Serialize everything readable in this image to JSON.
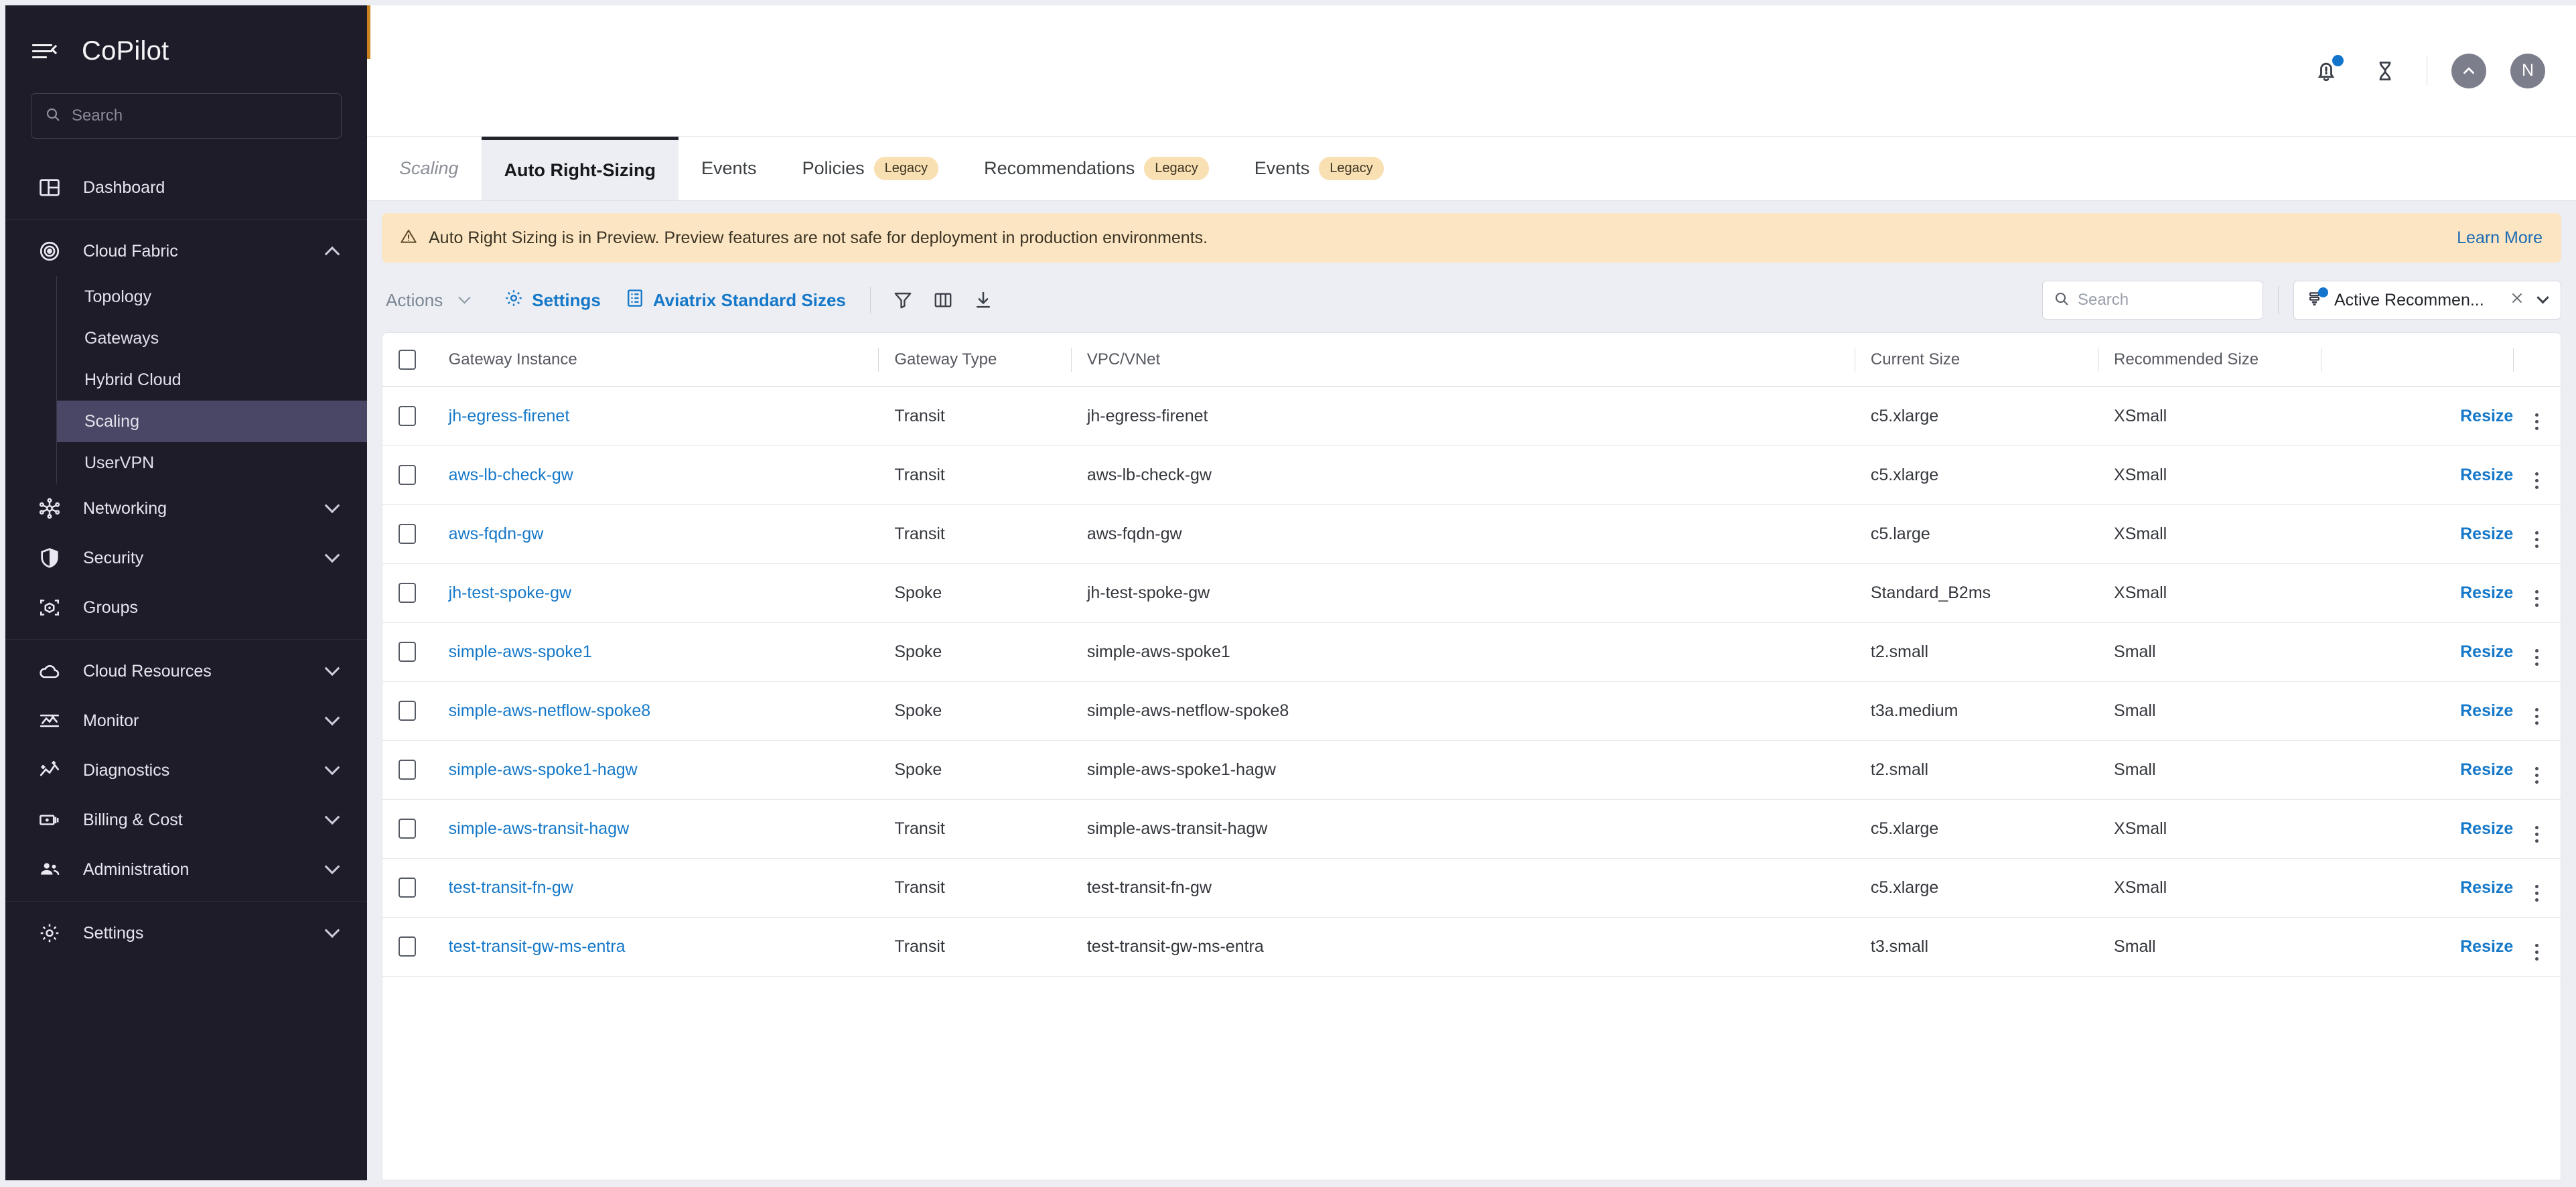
{
  "brand": {
    "title": "CoPilot",
    "menu_icon": "hamburger-collapse-icon"
  },
  "sidebar": {
    "search": {
      "placeholder": "Search",
      "value": "",
      "icon": "search-icon"
    },
    "items": [
      {
        "label": "Dashboard",
        "icon": "dashboard-icon",
        "expandable": false
      },
      {
        "label": "Cloud Fabric",
        "icon": "target-icon",
        "expandable": true,
        "expanded": true,
        "children": [
          {
            "label": "Topology",
            "active": false
          },
          {
            "label": "Gateways",
            "active": false
          },
          {
            "label": "Hybrid Cloud",
            "active": false
          },
          {
            "label": "Scaling",
            "active": true
          },
          {
            "label": "UserVPN",
            "active": false
          }
        ]
      },
      {
        "label": "Networking",
        "icon": "network-nodes-icon",
        "expandable": true,
        "expanded": false
      },
      {
        "label": "Security",
        "icon": "shield-icon",
        "expandable": true,
        "expanded": false
      },
      {
        "label": "Groups",
        "icon": "groups-cube-icon",
        "expandable": false
      },
      {
        "label": "Cloud Resources",
        "icon": "cloud-icon",
        "expandable": true,
        "expanded": false
      },
      {
        "label": "Monitor",
        "icon": "monitor-icon",
        "expandable": true,
        "expanded": false
      },
      {
        "label": "Diagnostics",
        "icon": "diagnostics-icon",
        "expandable": true,
        "expanded": false
      },
      {
        "label": "Billing & Cost",
        "icon": "money-icon",
        "expandable": true,
        "expanded": false
      },
      {
        "label": "Administration",
        "icon": "people-icon",
        "expandable": true,
        "expanded": false
      },
      {
        "label": "Settings",
        "icon": "gear-icon",
        "expandable": true,
        "expanded": false
      }
    ]
  },
  "topbar": {
    "notifications_icon": "bell-alert-icon",
    "has_notification_dot": true,
    "hourglass_icon": "hourglass-icon",
    "collapse_icon": "chevron-up-circle-icon",
    "avatar_initial": "N"
  },
  "tabs": [
    {
      "label": "Scaling",
      "active": false,
      "breadcrumb": true,
      "badge": null
    },
    {
      "label": "Auto Right-Sizing",
      "active": true,
      "breadcrumb": false,
      "badge": null
    },
    {
      "label": "Events",
      "active": false,
      "breadcrumb": false,
      "badge": null
    },
    {
      "label": "Policies",
      "active": false,
      "breadcrumb": false,
      "badge": "Legacy"
    },
    {
      "label": "Recommendations",
      "active": false,
      "breadcrumb": false,
      "badge": "Legacy"
    },
    {
      "label": "Events",
      "active": false,
      "breadcrumb": false,
      "badge": "Legacy"
    }
  ],
  "banner": {
    "icon": "warning-triangle-icon",
    "text": "Auto Right Sizing is in Preview. Preview features are not safe for deployment in production environments.",
    "link_label": "Learn More",
    "bg_color": "#fbe5c2",
    "link_color": "#1b6bb5"
  },
  "toolbar": {
    "actions_label": "Actions",
    "settings_label": "Settings",
    "settings_icon": "gear-icon",
    "standard_sizes_label": "Aviatrix Standard Sizes",
    "standard_sizes_icon": "list-document-icon",
    "filter_icon": "funnel-icon",
    "columns_icon": "columns-icon",
    "download_icon": "download-icon",
    "search": {
      "placeholder": "Search",
      "value": "",
      "icon": "search-icon"
    },
    "filter_chip": {
      "icon": "saved-filter-icon",
      "label": "Active Recommen...",
      "clear_icon": "close-icon",
      "caret_icon": "chevron-down-icon",
      "has_dot": true
    },
    "accent_color": "#1578c8"
  },
  "table": {
    "select_all_checkbox": false,
    "columns": [
      "Gateway Instance",
      "Gateway Type",
      "VPC/VNet",
      "Current Size",
      "Recommended Size"
    ],
    "action_label": "Resize",
    "row_menu_icon": "kebab-menu-icon",
    "rows": [
      {
        "checked": false,
        "gateway_instance": "jh-egress-firenet",
        "gateway_type": "Transit",
        "vpc_vnet": "jh-egress-firenet",
        "current_size": "c5.xlarge",
        "recommended_size": "XSmall"
      },
      {
        "checked": false,
        "gateway_instance": "aws-lb-check-gw",
        "gateway_type": "Transit",
        "vpc_vnet": "aws-lb-check-gw",
        "current_size": "c5.xlarge",
        "recommended_size": "XSmall"
      },
      {
        "checked": false,
        "gateway_instance": "aws-fqdn-gw",
        "gateway_type": "Transit",
        "vpc_vnet": "aws-fqdn-gw",
        "current_size": "c5.large",
        "recommended_size": "XSmall"
      },
      {
        "checked": false,
        "gateway_instance": "jh-test-spoke-gw",
        "gateway_type": "Spoke",
        "vpc_vnet": "jh-test-spoke-gw",
        "current_size": "Standard_B2ms",
        "recommended_size": "XSmall"
      },
      {
        "checked": false,
        "gateway_instance": "simple-aws-spoke1",
        "gateway_type": "Spoke",
        "vpc_vnet": "simple-aws-spoke1",
        "current_size": "t2.small",
        "recommended_size": "Small"
      },
      {
        "checked": false,
        "gateway_instance": "simple-aws-netflow-spoke8",
        "gateway_type": "Spoke",
        "vpc_vnet": "simple-aws-netflow-spoke8",
        "current_size": "t3a.medium",
        "recommended_size": "Small"
      },
      {
        "checked": false,
        "gateway_instance": "simple-aws-spoke1-hagw",
        "gateway_type": "Spoke",
        "vpc_vnet": "simple-aws-spoke1-hagw",
        "current_size": "t2.small",
        "recommended_size": "Small"
      },
      {
        "checked": false,
        "gateway_instance": "simple-aws-transit-hagw",
        "gateway_type": "Transit",
        "vpc_vnet": "simple-aws-transit-hagw",
        "current_size": "c5.xlarge",
        "recommended_size": "XSmall"
      },
      {
        "checked": false,
        "gateway_instance": "test-transit-fn-gw",
        "gateway_type": "Transit",
        "vpc_vnet": "test-transit-fn-gw",
        "current_size": "c5.xlarge",
        "recommended_size": "XSmall"
      },
      {
        "checked": false,
        "gateway_instance": "test-transit-gw-ms-entra",
        "gateway_type": "Transit",
        "vpc_vnet": "test-transit-gw-ms-entra",
        "current_size": "t3.small",
        "recommended_size": "Small"
      }
    ]
  }
}
